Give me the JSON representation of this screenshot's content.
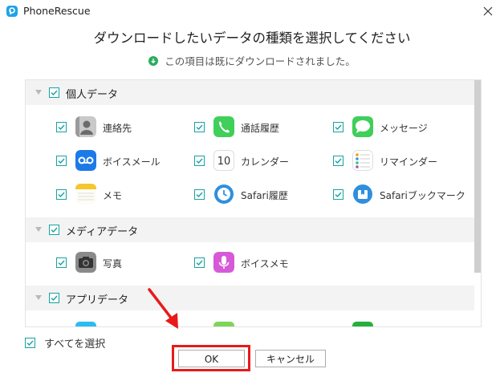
{
  "window": {
    "app_title": "PhoneRescue",
    "close_icon": "close-icon"
  },
  "heading": "ダウンロードしたいデータの種類を選択してください",
  "status": {
    "text": "この項目は既にダウンロードされました。",
    "icon": "download-done-icon",
    "color": "#27ae60"
  },
  "sections": [
    {
      "label": "個人データ",
      "checked": true,
      "items": [
        {
          "label": "連絡先",
          "icon": "contacts-icon",
          "checked": true
        },
        {
          "label": "通話履歴",
          "icon": "phone-icon",
          "checked": true
        },
        {
          "label": "メッセージ",
          "icon": "messages-icon",
          "checked": true
        },
        {
          "label": "ボイスメール",
          "icon": "voicemail-icon",
          "checked": true
        },
        {
          "label": "カレンダー",
          "icon": "calendar-icon",
          "checked": true,
          "icon_text": "10"
        },
        {
          "label": "リマインダー",
          "icon": "reminders-icon",
          "checked": true
        },
        {
          "label": "メモ",
          "icon": "notes-icon",
          "checked": true
        },
        {
          "label": "Safari履歴",
          "icon": "safari-history-icon",
          "checked": true
        },
        {
          "label": "Safariブックマーク",
          "icon": "safari-bookmark-icon",
          "checked": true
        }
      ]
    },
    {
      "label": "メディアデータ",
      "checked": true,
      "items": [
        {
          "label": "写真",
          "icon": "camera-icon",
          "checked": true
        },
        {
          "label": "ボイスメモ",
          "icon": "voice-memo-icon",
          "checked": true
        }
      ]
    },
    {
      "label": "アプリデータ",
      "checked": true,
      "items": []
    }
  ],
  "footer": {
    "select_all_label": "すべてを選択",
    "select_all_checked": true,
    "ok_label": "OK",
    "cancel_label": "キャンセル"
  },
  "colors": {
    "accent": "#17a2a2",
    "highlight": "#e81a1a",
    "arrow": "#e81a1a"
  }
}
